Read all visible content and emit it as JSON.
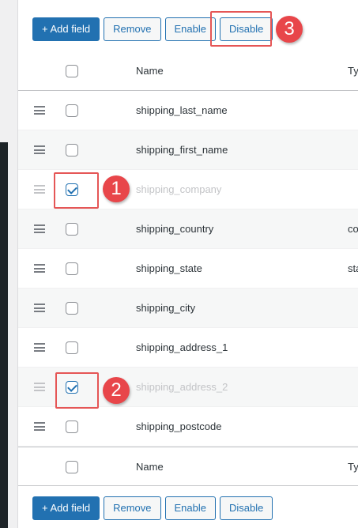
{
  "toolbar": {
    "add_field": "+ Add field",
    "remove": "Remove",
    "enable": "Enable",
    "disable": "Disable"
  },
  "table": {
    "header": {
      "name": "Name",
      "type": "Ty"
    },
    "footer": {
      "name": "Name",
      "type": "Ty"
    },
    "rows": [
      {
        "name": "shipping_last_name",
        "type": "",
        "checked": false,
        "disabled": false
      },
      {
        "name": "shipping_first_name",
        "type": "",
        "checked": false,
        "disabled": false
      },
      {
        "name": "shipping_company",
        "type": "",
        "checked": true,
        "disabled": true
      },
      {
        "name": "shipping_country",
        "type": "co",
        "checked": false,
        "disabled": false
      },
      {
        "name": "shipping_state",
        "type": "sta",
        "checked": false,
        "disabled": false
      },
      {
        "name": "shipping_city",
        "type": "",
        "checked": false,
        "disabled": false
      },
      {
        "name": "shipping_address_1",
        "type": "",
        "checked": false,
        "disabled": false
      },
      {
        "name": "shipping_address_2",
        "type": "",
        "checked": true,
        "disabled": true
      },
      {
        "name": "shipping_postcode",
        "type": "",
        "checked": false,
        "disabled": false
      }
    ]
  },
  "annotations": {
    "step1": "1",
    "step2": "2",
    "step3": "3"
  },
  "colors": {
    "primary": "#2271b1",
    "annotation": "#e8464a"
  }
}
